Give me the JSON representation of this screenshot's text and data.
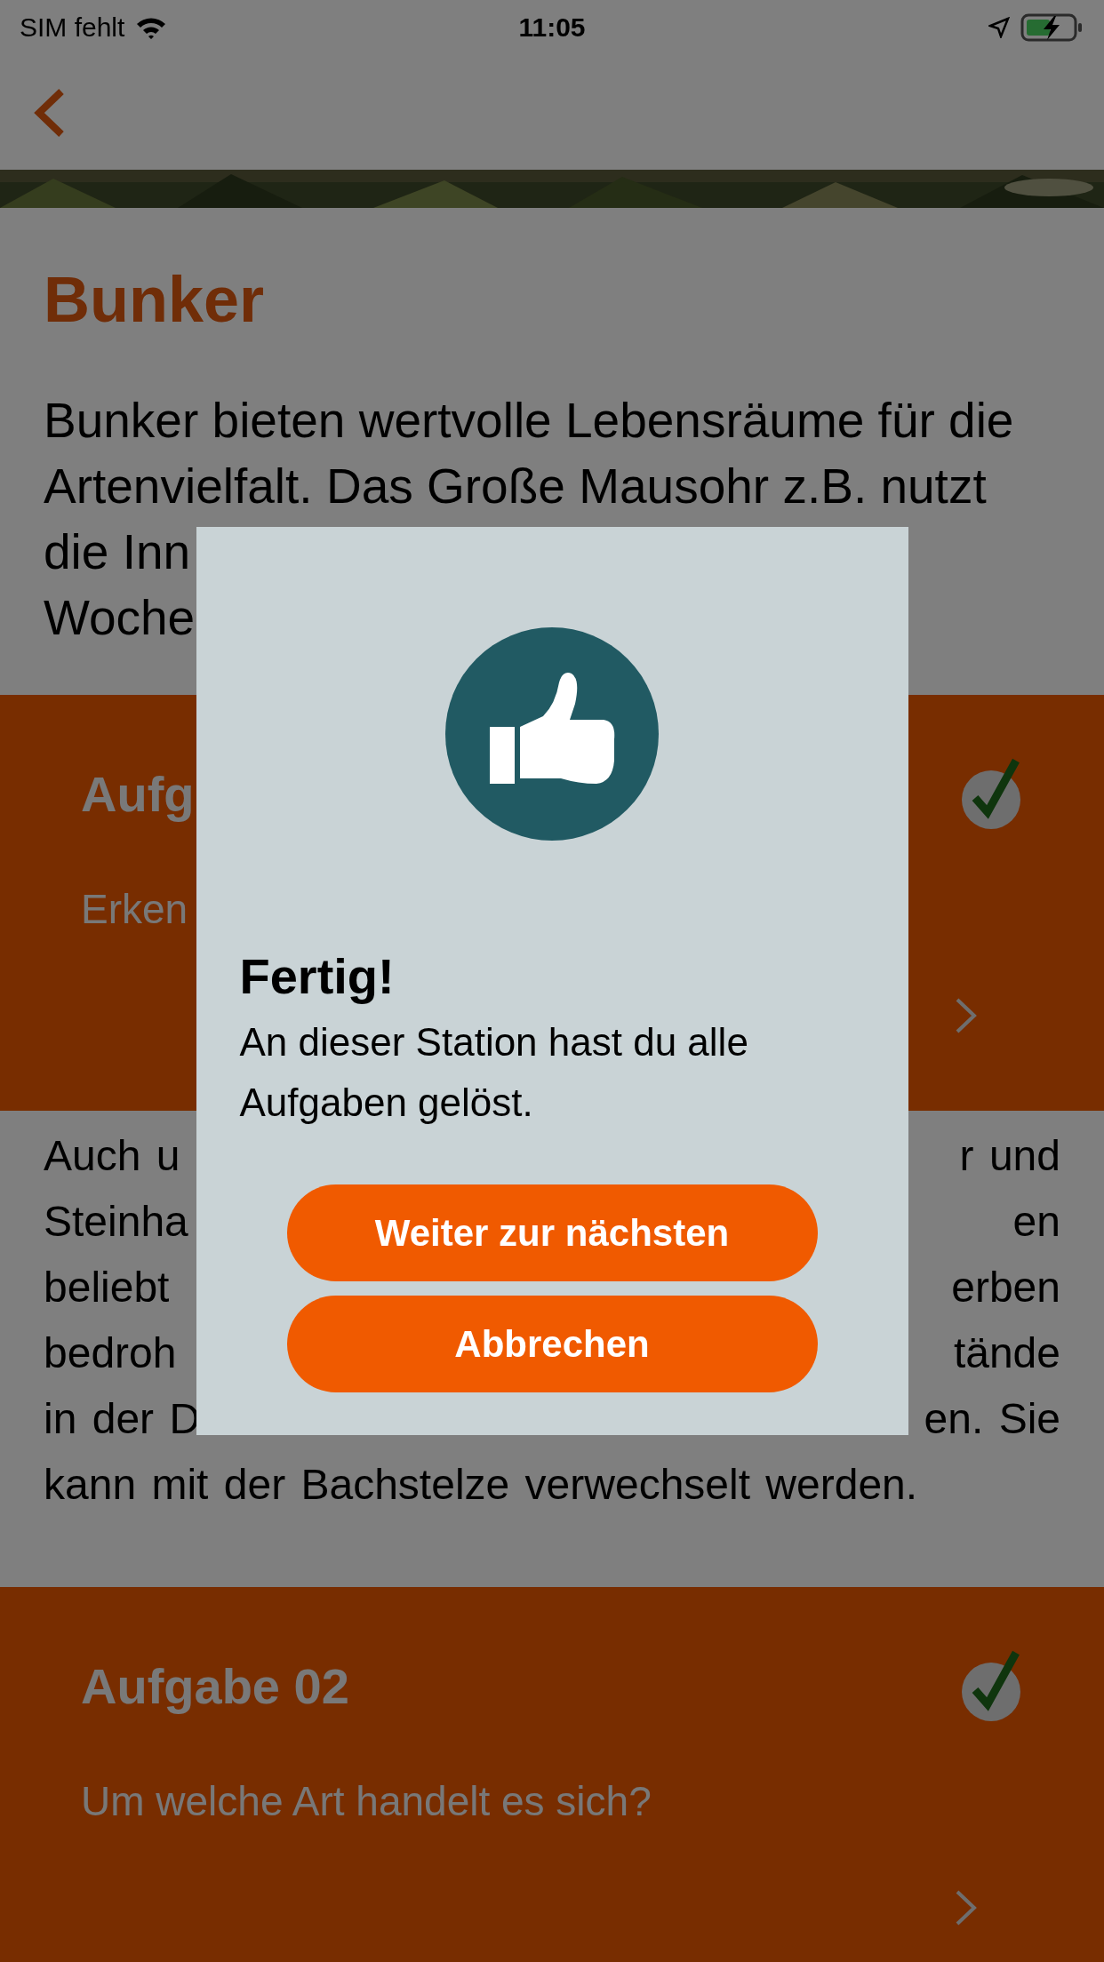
{
  "status_bar": {
    "carrier": "SIM fehlt",
    "time": "11:05"
  },
  "content": [
    {
      "kind": "title",
      "text": "Bunker"
    },
    {
      "kind": "paragraph",
      "lines": [
        {
          "left": "Bunker bieten wertvolle Lebensräume für die"
        },
        {
          "left": "Artenvielfalt. Das Große Mausohr z.B. nutzt"
        },
        {
          "left": "die Inn"
        },
        {
          "left": "Woche"
        }
      ]
    },
    {
      "kind": "task",
      "title": "Aufg",
      "subtitle": "Erken",
      "done": true
    },
    {
      "kind": "paragraph",
      "lines": [
        {
          "left": "Auch u",
          "right": "r und"
        },
        {
          "left": "Steinha",
          "right": "en"
        },
        {
          "left": "beliebt",
          "right": "erben"
        },
        {
          "left": "bedroh",
          "right": "tände"
        },
        {
          "left": "in der D",
          "right": "en. Sie"
        },
        {
          "left": "kann mit der Bachstelze verwechselt werden."
        }
      ]
    },
    {
      "kind": "task",
      "title": "Aufgabe 02",
      "subtitle": "Um welche Art handelt es sich?",
      "done": true
    }
  ],
  "dialog": {
    "title": "Fertig!",
    "message": "An dieser Station hast du alle Aufgaben gelöst.",
    "buttons": [
      "Weiter zur nächsten",
      "Abbrechen"
    ]
  }
}
